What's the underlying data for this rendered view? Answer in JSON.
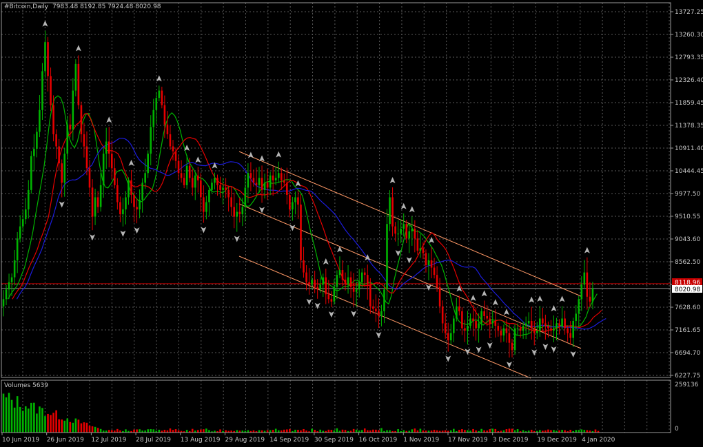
{
  "chart_data": {
    "type": "candlestick",
    "title": "#Bitcoin,Daily",
    "ohlc_text": "7983.48 8192.85 7924.48 8020.98",
    "volume_label": "Volumes 5639",
    "volume_max_label": "259136",
    "volume_zero_label": "0",
    "bid_price": "8118.96",
    "current_price": "8020.98",
    "y_tick_labels": [
      "13727.25",
      "13260.30",
      "12793.35",
      "12326.40",
      "11859.45",
      "11378.35",
      "10911.40",
      "10444.45",
      "9977.50",
      "9510.55",
      "9043.60",
      "8562.50",
      "8095.55",
      "7628.60",
      "7161.65",
      "6694.70",
      "6227.75"
    ],
    "y_range": [
      6227.75,
      13727.25
    ],
    "x_tick_labels": [
      "10 Jun 2019",
      "26 Jun 2019",
      "12 Jul 2019",
      "28 Jul 2019",
      "13 Aug 2019",
      "29 Aug 2019",
      "14 Sep 2019",
      "30 Sep 2019",
      "16 Oct 2019",
      "1 Nov 2019",
      "17 Nov 2019",
      "3 Dec 2019",
      "19 Dec 2019",
      "4 Jan 2020"
    ],
    "days": 215,
    "closes": [
      7800,
      8000,
      8150,
      8250,
      8600,
      9050,
      9300,
      9450,
      9650,
      10050,
      10750,
      10900,
      11250,
      11700,
      12500,
      13100,
      12400,
      11800,
      11200,
      10950,
      10600,
      10200,
      10800,
      11400,
      11300,
      12100,
      12650,
      11800,
      11200,
      10950,
      10500,
      10100,
      9500,
      9900,
      9700,
      10150,
      10800,
      11050,
      10800,
      10500,
      10150,
      9800,
      9550,
      9650,
      9900,
      10250,
      9950,
      9700,
      9650,
      9850,
      10200,
      10400,
      10800,
      11350,
      11700,
      11950,
      12100,
      11800,
      11400,
      11200,
      10950,
      10850,
      10650,
      10400,
      10300,
      10150,
      10550,
      10300,
      10100,
      10350,
      10250,
      9900,
      9600,
      9800,
      10050,
      10200,
      10300,
      10150,
      10050,
      10100,
      10050,
      9900,
      9700,
      9500,
      9600,
      9550,
      9700,
      10100,
      10400,
      10300,
      10200,
      10150,
      10300,
      10050,
      10200,
      10100,
      10350,
      10250,
      10300,
      10400,
      10250,
      10200,
      9950,
      9650,
      9800,
      9900,
      9750,
      8600,
      8350,
      8150,
      8100,
      8200,
      8050,
      8000,
      8100,
      8250,
      7900,
      7800,
      7750,
      8050,
      8300,
      8400,
      8200,
      8100,
      8250,
      8050,
      7950,
      8000,
      8150,
      8350,
      8300,
      8100,
      7650,
      7600,
      7550,
      7450,
      7550,
      8000,
      9350,
      9900,
      9300,
      9150,
      9150,
      9250,
      9350,
      9050,
      9200,
      9250,
      9050,
      8800,
      8850,
      8750,
      8500,
      8600,
      8450,
      8300,
      8050,
      7650,
      7300,
      7100,
      6950,
      7100,
      7400,
      7650,
      7550,
      7200,
      7150,
      7250,
      7400,
      7350,
      7200,
      7300,
      7550,
      7450,
      7400,
      7300,
      7350,
      7250,
      7150,
      7050,
      7200,
      7100,
      6900,
      6750,
      7200,
      7200,
      7150,
      7250,
      7300,
      7350,
      7200,
      7100,
      7150,
      7400,
      7300,
      7250,
      7200,
      7150,
      7200,
      7300,
      7250,
      7400,
      7200,
      7100,
      7000,
      7350,
      7500,
      7800,
      8100,
      8350,
      7850,
      7750,
      8020.98
    ],
    "volume_profile": [
      0.78,
      0.76,
      0.74,
      0.72,
      0.7,
      0.68,
      0.66,
      0.64,
      0.62,
      0.6,
      0.58,
      0.56,
      0.54,
      0.52,
      0.5,
      0.48,
      0.46,
      0.44,
      0.42,
      0.4,
      0.38,
      0.36,
      0.34,
      0.32,
      0.3,
      0.28,
      0.26,
      0.24,
      0.22,
      0.2,
      0.18,
      0.16,
      0.14,
      0.12,
      0.1,
      0.08
    ]
  }
}
